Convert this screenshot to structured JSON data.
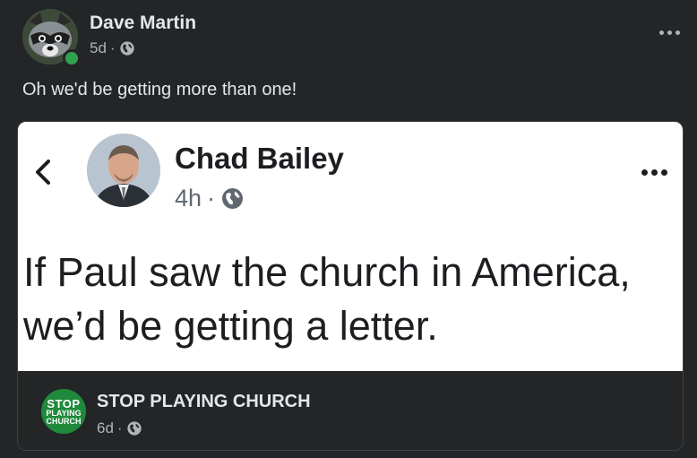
{
  "post": {
    "author": "Dave Martin",
    "time": "5d",
    "separator": "·",
    "visibility_icon": "globe-icon",
    "caption": "Oh we'd be getting more than one!",
    "more_icon": "more-horizontal-icon"
  },
  "shared_image": {
    "back_icon": "chevron-left-icon",
    "name": "Chad Bailey",
    "time": "4h",
    "separator": "·",
    "visibility_icon": "globe-icon",
    "text_line1": "If Paul saw the church in America,",
    "text_line2": "we’d be getting a letter."
  },
  "source_page": {
    "name": "STOP PLAYING CHURCH",
    "logo_line1": "STOP",
    "logo_line2": "PLAYING",
    "logo_line3": "CHURCH",
    "time": "6d",
    "separator": "·",
    "visibility_icon": "globe-icon"
  },
  "colors": {
    "background": "#242526",
    "text_primary": "#e4e6eb",
    "text_secondary": "#b0b3b8",
    "online": "#31a24c",
    "logo_green": "#1f8a3b"
  }
}
